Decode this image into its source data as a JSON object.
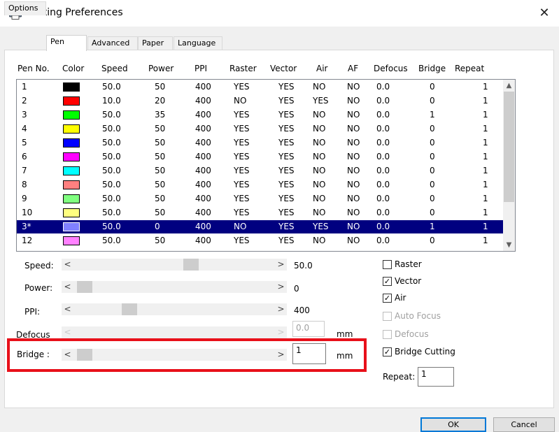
{
  "window": {
    "title": "Printing Preferences",
    "close_glyph": "✕",
    "icon": "printer-icon"
  },
  "tabs": [
    {
      "label": "Options"
    },
    {
      "label": "Pen"
    },
    {
      "label": "Advanced"
    },
    {
      "label": "Paper"
    },
    {
      "label": "Language"
    }
  ],
  "table": {
    "columns": [
      "Pen No.",
      "Color",
      "Speed",
      "Power",
      "PPI",
      "Raster",
      "Vector",
      "Air",
      "AF",
      "Defocus",
      "Bridge",
      "Repeat"
    ],
    "rows": [
      {
        "pen": "1",
        "color": "#000000",
        "speed": "50.0",
        "power": "50",
        "ppi": "400",
        "raster": "YES",
        "vector": "YES",
        "air": "NO",
        "af": "NO",
        "defocus": "0.0",
        "bridge": "0",
        "repeat": "1"
      },
      {
        "pen": "2",
        "color": "#ff0000",
        "speed": "10.0",
        "power": "20",
        "ppi": "400",
        "raster": "NO",
        "vector": "YES",
        "air": "YES",
        "af": "NO",
        "defocus": "0.0",
        "bridge": "0",
        "repeat": "1"
      },
      {
        "pen": "3",
        "color": "#00ff00",
        "speed": "50.0",
        "power": "35",
        "ppi": "400",
        "raster": "YES",
        "vector": "YES",
        "air": "NO",
        "af": "NO",
        "defocus": "0.0",
        "bridge": "1",
        "repeat": "1"
      },
      {
        "pen": "4",
        "color": "#ffff00",
        "speed": "50.0",
        "power": "50",
        "ppi": "400",
        "raster": "YES",
        "vector": "YES",
        "air": "NO",
        "af": "NO",
        "defocus": "0.0",
        "bridge": "0",
        "repeat": "1"
      },
      {
        "pen": "5",
        "color": "#0000ff",
        "speed": "50.0",
        "power": "50",
        "ppi": "400",
        "raster": "YES",
        "vector": "YES",
        "air": "NO",
        "af": "NO",
        "defocus": "0.0",
        "bridge": "0",
        "repeat": "1"
      },
      {
        "pen": "6",
        "color": "#ff00ff",
        "speed": "50.0",
        "power": "50",
        "ppi": "400",
        "raster": "YES",
        "vector": "YES",
        "air": "NO",
        "af": "NO",
        "defocus": "0.0",
        "bridge": "0",
        "repeat": "1"
      },
      {
        "pen": "7",
        "color": "#00ffff",
        "speed": "50.0",
        "power": "50",
        "ppi": "400",
        "raster": "YES",
        "vector": "YES",
        "air": "NO",
        "af": "NO",
        "defocus": "0.0",
        "bridge": "0",
        "repeat": "1"
      },
      {
        "pen": "8",
        "color": "#ff8080",
        "speed": "50.0",
        "power": "50",
        "ppi": "400",
        "raster": "YES",
        "vector": "YES",
        "air": "NO",
        "af": "NO",
        "defocus": "0.0",
        "bridge": "0",
        "repeat": "1"
      },
      {
        "pen": "9",
        "color": "#80ff80",
        "speed": "50.0",
        "power": "50",
        "ppi": "400",
        "raster": "YES",
        "vector": "YES",
        "air": "NO",
        "af": "NO",
        "defocus": "0.0",
        "bridge": "0",
        "repeat": "1"
      },
      {
        "pen": "10",
        "color": "#ffff80",
        "speed": "50.0",
        "power": "50",
        "ppi": "400",
        "raster": "YES",
        "vector": "YES",
        "air": "NO",
        "af": "NO",
        "defocus": "0.0",
        "bridge": "0",
        "repeat": "1"
      },
      {
        "pen": "3*",
        "color": "#8080ff",
        "speed": "50.0",
        "power": "0",
        "ppi": "400",
        "raster": "NO",
        "vector": "YES",
        "air": "YES",
        "af": "NO",
        "defocus": "0.0",
        "bridge": "1",
        "repeat": "1",
        "selected": true
      },
      {
        "pen": "12",
        "color": "#ff80ff",
        "speed": "50.0",
        "power": "50",
        "ppi": "400",
        "raster": "YES",
        "vector": "YES",
        "air": "NO",
        "af": "NO",
        "defocus": "0.0",
        "bridge": "0",
        "repeat": "1"
      }
    ]
  },
  "settings": {
    "speed": {
      "label": "Speed:",
      "value": "50.0"
    },
    "power": {
      "label": "Power:",
      "value": "0"
    },
    "ppi": {
      "label": "PPI:",
      "value": "400"
    },
    "defocus": {
      "label": "Defocus",
      "value": "0.0",
      "unit": "mm"
    },
    "bridge": {
      "label": "Bridge :",
      "value": "1",
      "unit": "mm"
    },
    "scroll_left": "<",
    "scroll_right": ">"
  },
  "checkboxes": {
    "raster": {
      "label": "Raster",
      "checked": false
    },
    "vector": {
      "label": "Vector",
      "checked": true
    },
    "air": {
      "label": "Air",
      "checked": true
    },
    "auto_focus": {
      "label": "Auto Focus",
      "checked": false
    },
    "defocus": {
      "label": "Defocus",
      "checked": false
    },
    "bridge_cutting": {
      "label": "Bridge Cutting",
      "checked": true
    },
    "check_glyph": "✓"
  },
  "repeat": {
    "label": "Repeat:",
    "value": "1"
  },
  "buttons": {
    "ok": "OK",
    "cancel": "Cancel"
  },
  "colors": {
    "selection": "#000080",
    "highlight_frame": "#e8101a",
    "default_button_border": "#0078d7"
  }
}
